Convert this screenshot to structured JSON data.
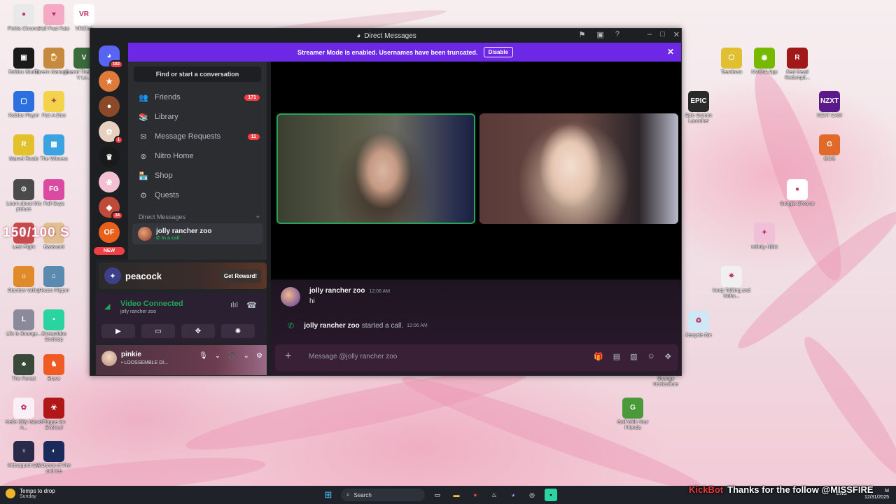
{
  "desktop": {
    "left_icons": [
      {
        "label": "Pinkie Chrome",
        "color": "#e9e9e9",
        "glyph": "●"
      },
      {
        "label": "Half Past Fate",
        "color": "#f4a9c4",
        "glyph": "♥"
      },
      {
        "label": "VRChat",
        "color": "#ffffff",
        "glyph": "VR"
      },
      {
        "label": "Roblox Studio",
        "color": "#1a1a1a",
        "glyph": "▣"
      },
      {
        "label": "Tavern Manage...",
        "color": "#c58a3e",
        "glyph": "🍺"
      },
      {
        "label": "Grand Theft Auto V Le...",
        "color": "#3b6b3b",
        "glyph": "V"
      },
      {
        "label": "Roblox Player",
        "color": "#2c6fe0",
        "glyph": "▢"
      },
      {
        "label": "Pair A Dice",
        "color": "#f2d34a",
        "glyph": "✦"
      },
      {
        "label": "Marvel Rivals",
        "color": "#e3c12a",
        "glyph": "R"
      },
      {
        "label": "The Witness",
        "color": "#3aa3e0",
        "glyph": "▦"
      },
      {
        "label": "Learn about this picture",
        "color": "#4a4a4a",
        "glyph": "⊙"
      },
      {
        "label": "Fall Guys",
        "color": "#d94aa0",
        "glyph": "FG"
      },
      {
        "label": "Last Flight",
        "color": "#c84a4a",
        "glyph": "✈"
      },
      {
        "label": "Bastward",
        "color": "#e0c090",
        "glyph": "▲"
      },
      {
        "label": "Stardew Valley",
        "color": "#e08a2a",
        "glyph": "☼"
      },
      {
        "label": "House Flipper",
        "color": "#5a8ab0",
        "glyph": "⌂"
      },
      {
        "label": "Life is Strange...",
        "color": "#8a8a9a",
        "glyph": "L"
      },
      {
        "label": "Streamlabs Desktop",
        "color": "#2ad4a0",
        "glyph": "▪"
      },
      {
        "label": "The Forest",
        "color": "#3a4a3a",
        "glyph": "♣"
      },
      {
        "label": "Brave",
        "color": "#f05a24",
        "glyph": "♞"
      },
      {
        "label": "Hello Kitty Island A...",
        "color": "#f8f0f4",
        "glyph": "✿"
      },
      {
        "label": "Plague Inc Evolved",
        "color": "#b01818",
        "glyph": "☣"
      },
      {
        "label": "Kidnapped Girl",
        "color": "#2a2a4a",
        "glyph": "♀"
      },
      {
        "label": "A Dance of Fire and Ice",
        "color": "#1a2a5a",
        "glyph": "◐"
      }
    ],
    "right_icons": [
      {
        "label": "Teardown",
        "color": "#e0c030",
        "glyph": "⬡"
      },
      {
        "label": "NVIDIA App",
        "color": "#76b900",
        "glyph": "◉"
      },
      {
        "label": "Red Dead Redempti...",
        "color": "#a01818",
        "glyph": "R"
      },
      {
        "label": "Epic Games Launcher",
        "color": "#2a2a2a",
        "glyph": "EPIC"
      },
      {
        "label": "NZXT CAM",
        "color": "#5a1a8a",
        "glyph": "NZXT"
      },
      {
        "label": "GOG",
        "color": "#e06a2a",
        "glyph": "G"
      },
      {
        "label": "Google Chrome",
        "color": "#ffffff",
        "glyph": "●"
      },
      {
        "label": "Infinity Nikki",
        "color": "#f0c0d8",
        "glyph": "✦"
      },
      {
        "label": "Keep Talking and Nobo...",
        "color": "#f0f0f0",
        "glyph": "✷"
      },
      {
        "label": "Recycle Bin",
        "color": "#cfe8f5",
        "glyph": "♻"
      },
      {
        "label": "Strange Horticulture",
        "color": "#c0a080",
        "glyph": "❦"
      },
      {
        "label": "Golf With Your Friends",
        "color": "#4a9a3a",
        "glyph": "G"
      }
    ],
    "overlay_counter": "150/100 S"
  },
  "window": {
    "title": "Direct Messages",
    "streamer_banner": {
      "text": "Streamer Mode is enabled. Usernames have been truncated.",
      "button": "Disable"
    },
    "servers": [
      {
        "badge": "182",
        "color": "#5865f2",
        "glyph": "◕"
      },
      {
        "badge": "",
        "color": "#e07a3a",
        "glyph": "★"
      },
      {
        "badge": "",
        "color": "#8a4a2a",
        "glyph": "●"
      },
      {
        "badge": "1",
        "color": "#e8d0c0",
        "glyph": "✿"
      },
      {
        "badge": "",
        "color": "#1a1a1a",
        "glyph": "♛"
      },
      {
        "badge": "",
        "color": "#f2c0d0",
        "glyph": "❀"
      },
      {
        "badge": "34",
        "color": "#c04a3a",
        "glyph": "◆"
      },
      {
        "badge": "",
        "color": "#e8601a",
        "glyph": "OF"
      }
    ],
    "new_label": "NEW",
    "sidebar": {
      "search_label": "Find or start a conversation",
      "nav": [
        {
          "label": "Friends",
          "badge": "171",
          "icon": "👥"
        },
        {
          "label": "Library",
          "badge": "",
          "icon": "📚"
        },
        {
          "label": "Message Requests",
          "badge": "11",
          "icon": "✉"
        },
        {
          "label": "Nitro Home",
          "badge": "",
          "icon": "⊛"
        },
        {
          "label": "Shop",
          "badge": "",
          "icon": "🏪"
        },
        {
          "label": "Quests",
          "badge": "",
          "icon": "⚙"
        }
      ],
      "dm_header": "Direct Messages",
      "dm_add": "+",
      "dm": {
        "name": "jolly rancher zoo",
        "status": "In a call"
      }
    },
    "promo": {
      "brand": "peacock",
      "button": "Get Reward!"
    },
    "voice": {
      "status": "Video Connected",
      "channel": "jolly rancher zoo"
    },
    "user": {
      "name": "pinkie",
      "status": "• LOOSSEMBLE DI..."
    },
    "chat": {
      "messages": [
        {
          "author": "jolly rancher zoo",
          "time": "12:06 AM",
          "text": "hi"
        }
      ],
      "call_event": {
        "author": "jolly rancher zoo",
        "text": "started a call.",
        "time": "12:06 AM"
      },
      "placeholder": "Message @jolly rancher zoo"
    }
  },
  "taskbar": {
    "weather_title": "Temps to drop",
    "weather_sub": "Sunday",
    "search": "Search",
    "lang": "ENG",
    "time": "M",
    "date": "12/31/2025"
  },
  "stream_overlay": {
    "bot": "KickBot",
    "message": "Thanks for the follow @MISSFIRE"
  }
}
